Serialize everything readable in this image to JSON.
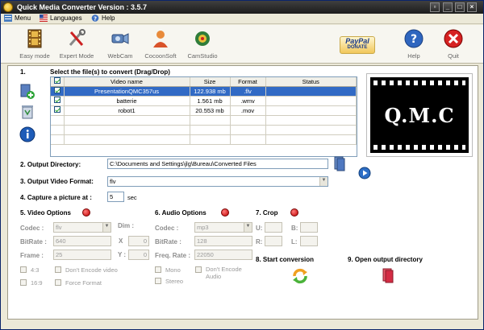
{
  "window": {
    "title": "Quick Media Converter   Version : 3.5.7"
  },
  "menubar": [
    {
      "label": "Menu",
      "icon": "menu-icon"
    },
    {
      "label": "Languages",
      "icon": "us-flag-icon"
    },
    {
      "label": "Help",
      "icon": "help-icon"
    }
  ],
  "toolbar": {
    "easy": "Easy mode",
    "expert": "Expert Mode",
    "webcam": "WebCam",
    "cocoon": "CocoonSoft",
    "camstudio": "CamStudio",
    "paypal_line1": "PayPal",
    "paypal_line2": "DONATE",
    "help": "Help",
    "quit": "Quit"
  },
  "step1": {
    "number": "1.",
    "title": "Select the file(s) to convert (Drag/Drop)",
    "columns": [
      "Video name",
      "Size",
      "Format",
      "Status"
    ],
    "files": [
      {
        "name": "PresentationQMC357us",
        "size": "122.938 mb",
        "format": ".flv",
        "status": ""
      },
      {
        "name": "batterie",
        "size": "1.561 mb",
        "format": ".wmv",
        "status": ""
      },
      {
        "name": "robot1",
        "size": "20.553 mb",
        "format": ".mov",
        "status": ""
      }
    ]
  },
  "preview_text": "Q.M.C",
  "step2": {
    "label": "2. Output Directory:",
    "value": "C:\\Documents and Settings\\jlg\\Bureau\\Converted Files"
  },
  "step3": {
    "label": "3. Output Video Format:",
    "value": "flv"
  },
  "step4": {
    "label": "4. Capture a picture at :",
    "value": "5",
    "unit": "sec"
  },
  "step5": {
    "label": "5. Video Options",
    "codec_label": "Codec :",
    "codec": "flv",
    "dim_label": "Dim :",
    "bitrate_label": "BitRate :",
    "bitrate": "640",
    "x_label": "X",
    "x_value": "0",
    "frame_label": "Frame :",
    "frame": "25",
    "y_label": "Y :",
    "y_value": "0",
    "ratio43": "4:3",
    "ratio169": "16:9",
    "dont_encode": "Don't Encode video",
    "force_format": "Force Format"
  },
  "step6": {
    "label": "6. Audio Options",
    "codec_label": "Codec :",
    "codec": "mp3",
    "bitrate_label": "BitRate :",
    "bitrate": "128",
    "freq_label": "Freq. Rate :",
    "freq": "22050",
    "mono": "Mono",
    "stereo": "Stereo",
    "dont_encode_1": "Don't Encode",
    "dont_encode_2": "Audio"
  },
  "step7": {
    "label": "7. Crop",
    "u": "U:",
    "b": "B:",
    "r": "R:",
    "l": "L:"
  },
  "step8": {
    "label": "8. Start conversion"
  },
  "step9": {
    "label": "9. Open output directory"
  },
  "colors": {
    "selection": "#316ac5",
    "title_bar": "#1c1c1c",
    "accent_red": "#c00000"
  }
}
